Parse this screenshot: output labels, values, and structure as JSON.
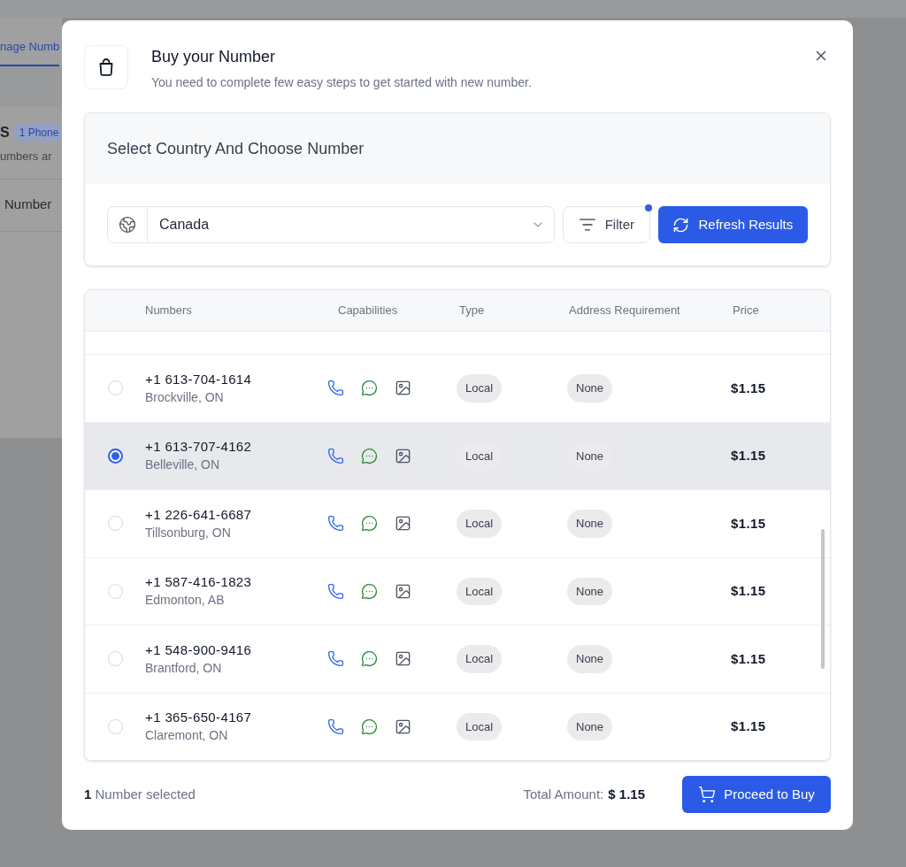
{
  "background": {
    "tab": "nage Numb",
    "heading": "S",
    "badge": "1 Phone",
    "subtitle": "umbers ar",
    "column": "Number"
  },
  "modal": {
    "title": "Buy your Number",
    "subtitle": "You need to complete few easy steps to get started with new number."
  },
  "section": {
    "title": "Select Country And Choose Number",
    "country": "Canada",
    "filter": {
      "label": "Filter",
      "active": true
    },
    "refresh": "Refresh Results"
  },
  "table": {
    "columns": [
      "Numbers",
      "Capabilities",
      "Type",
      "Address Requirement",
      "Price"
    ],
    "rows": [
      {
        "number": "+1 613-704-1614",
        "location": "Brockville, ON",
        "capabilities": [
          {
            "kind": "voice"
          },
          {
            "kind": "sms"
          },
          {
            "kind": "mms"
          }
        ],
        "type": "Local",
        "address": "None",
        "price": "$1.15",
        "selected": false
      },
      {
        "number": "+1 613-707-4162",
        "location": "Belleville, ON",
        "capabilities": [
          {
            "kind": "voice"
          },
          {
            "kind": "sms"
          },
          {
            "kind": "mms"
          }
        ],
        "type": "Local",
        "address": "None",
        "price": "$1.15",
        "selected": true
      },
      {
        "number": "+1 226-641-6687",
        "location": "Tillsonburg, ON",
        "capabilities": [
          {
            "kind": "voice"
          },
          {
            "kind": "sms"
          },
          {
            "kind": "mms"
          }
        ],
        "type": "Local",
        "address": "None",
        "price": "$1.15",
        "selected": false
      },
      {
        "number": "+1 587-416-1823",
        "location": "Edmonton, AB",
        "capabilities": [
          {
            "kind": "voice"
          },
          {
            "kind": "sms"
          },
          {
            "kind": "mms"
          }
        ],
        "type": "Local",
        "address": "None",
        "price": "$1.15",
        "selected": false
      },
      {
        "number": "+1 548-900-9416",
        "location": "Brantford, ON",
        "capabilities": [
          {
            "kind": "voice"
          },
          {
            "kind": "sms"
          },
          {
            "kind": "mms"
          }
        ],
        "type": "Local",
        "address": "None",
        "price": "$1.15",
        "selected": false
      },
      {
        "number": "+1 365-650-4167",
        "location": "Claremont, ON",
        "capabilities": [
          {
            "kind": "voice"
          },
          {
            "kind": "sms"
          },
          {
            "kind": "mms"
          }
        ],
        "type": "Local",
        "address": "None",
        "price": "$1.15",
        "selected": false
      }
    ]
  },
  "footer": {
    "selected_count": "**1** Number selected",
    "total_label": "Total Amount:",
    "total": "$ 1.15",
    "buy": "Proceed to Buy"
  }
}
